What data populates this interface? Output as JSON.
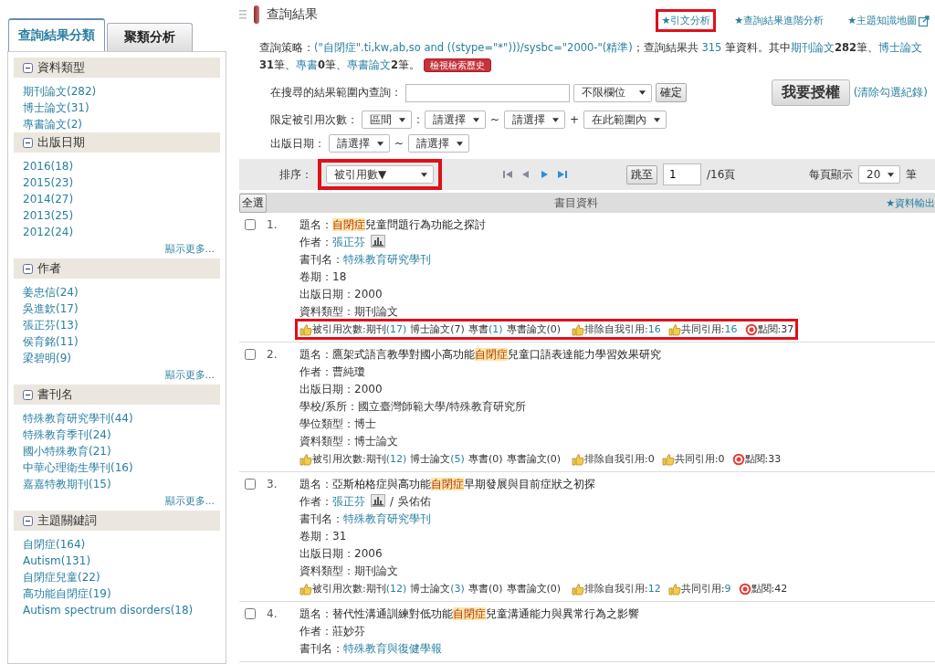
{
  "sidebar": {
    "tabs": [
      {
        "label": "查詢結果分類",
        "selected": true
      },
      {
        "label": "聚類分析",
        "selected": false
      }
    ],
    "sections": [
      {
        "title": "資料類型",
        "expanded": true,
        "items": [
          "期刊論文(282)",
          "博士論文(31)",
          "專書論文(2)"
        ]
      },
      {
        "title": "出版日期",
        "expanded": true,
        "items": [
          "2016(18)",
          "2015(23)",
          "2014(27)",
          "2013(25)",
          "2012(24)"
        ],
        "more": "顯示更多..."
      },
      {
        "title": "作者",
        "expanded": true,
        "items": [
          "姜忠信(24)",
          "吳進欽(17)",
          "張正芬(13)",
          "侯育銘(11)",
          "梁碧明(9)"
        ],
        "more": "顯示更多..."
      },
      {
        "title": "書刊名",
        "expanded": true,
        "items": [
          "特殊教育研究學刊(44)",
          "特殊教育季刊(24)",
          "國小特殊教育(21)",
          "中華心理衛生學刊(16)",
          "嘉嘉特教期刊(15)"
        ],
        "more": "顯示更多..."
      },
      {
        "title": "主題關鍵詞",
        "expanded": true,
        "items": [
          "自閉症(164)",
          "Autism(131)",
          "自閉症兒童(22)",
          "高功能自閉症(19)",
          "Autism spectrum disorders(18)"
        ]
      }
    ]
  },
  "header": {
    "title": "查詢結果",
    "links": [
      {
        "text": "★引文分析",
        "boxed": true,
        "external": false
      },
      {
        "text": "★查詢結果進階分析",
        "boxed": false,
        "external": false
      },
      {
        "text": "★主題知識地圖",
        "boxed": false,
        "external": true
      }
    ]
  },
  "summary": [
    {
      "text": "查詢策略：",
      "kind": "plain"
    },
    {
      "text": "(\"自閉症\".ti,kw,ab,so and ((stype=\"*\")))/sysbc=\"2000-\"(精準)",
      "kind": "link"
    },
    {
      "text": "；查詢結果共 ",
      "kind": "plain"
    },
    {
      "text": "315",
      "kind": "link"
    },
    {
      "text": " 筆資料。其中",
      "kind": "plain"
    },
    {
      "text": "期刊論文",
      "kind": "link"
    },
    {
      "text": "282",
      "kind": "bold"
    },
    {
      "text": "筆、",
      "kind": "plain"
    },
    {
      "text": "博士論文",
      "kind": "link"
    },
    {
      "text": "31",
      "kind": "bold"
    },
    {
      "text": "筆、",
      "kind": "plain"
    },
    {
      "text": "專書",
      "kind": "link"
    },
    {
      "text": "0",
      "kind": "bold"
    },
    {
      "text": "筆、",
      "kind": "plain"
    },
    {
      "text": "專書論文",
      "kind": "link"
    },
    {
      "text": "2",
      "kind": "bold"
    },
    {
      "text": "筆。",
      "kind": "plain"
    }
  ],
  "history_button": "檢視檢索歷史",
  "range_search": {
    "label": "在搜尋的結果範圍內查詢：",
    "field_select": "不限欄位",
    "button": "確定"
  },
  "license_button": "我要授權",
  "clear_link": "(清除勾選紀錄)",
  "citation_filter": {
    "label": "限定被引用次數：",
    "mode": "區間",
    "sep1": ":",
    "from": "請選擇",
    "sep2": "~",
    "to": "請選擇",
    "sep3": "+",
    "scope": "在此範圍內"
  },
  "date_filter": {
    "label": "出版日期：",
    "from": "請選擇",
    "sep": "~",
    "to": "請選擇"
  },
  "toolbar": {
    "sort_label": "排序：",
    "sort_value": "被引用數▼",
    "sort_boxed": true,
    "jump_button": "跳至",
    "page_value": "1",
    "page_total": "/16頁",
    "per_page_label": "每頁顯示",
    "per_page": "20",
    "per_page_unit": "筆"
  },
  "table_header": {
    "select_all": "全選",
    "column": "書目資料",
    "export": "★資料輸出"
  },
  "records": [
    {
      "number": "1.",
      "checked": false,
      "title_label": "題名：",
      "title_parts": [
        {
          "text": "自閉症",
          "highlight": true
        },
        {
          "text": "兒童問題行為功能之探討",
          "highlight": false
        }
      ],
      "fields": [
        {
          "label": "作者：",
          "values": [
            {
              "text": "張正芬",
              "link": true,
              "profile": true
            }
          ]
        },
        {
          "label": "書刊名：",
          "values": [
            {
              "text": "特殊教育研究學刊",
              "link": true,
              "profile": false
            }
          ]
        },
        {
          "label": "卷期：",
          "values": [
            {
              "text": "18",
              "link": false,
              "profile": false
            }
          ]
        },
        {
          "label": "出版日期：",
          "values": [
            {
              "text": "2000",
              "link": false,
              "profile": false
            }
          ]
        },
        {
          "label": "資料類型：",
          "values": [
            {
              "text": "期刊論文",
              "link": false,
              "profile": false
            }
          ]
        }
      ],
      "citation": {
        "boxed": true,
        "label": "被引用次數:",
        "counts": [
          {
            "label": "期刊",
            "count": "(17)",
            "link": true
          },
          {
            "label": "博士論文",
            "count": "(7)",
            "link": false
          },
          {
            "label": "專書",
            "count": "(1)",
            "link": true
          },
          {
            "label": "專書論文",
            "count": "(0)",
            "link": false
          }
        ],
        "self_label": "排除自我引用:",
        "self_value": "16",
        "self_link": true,
        "co_label": "共同引用:",
        "co_value": "16",
        "co_link": true,
        "views_label": "點閱:",
        "views": "37"
      }
    },
    {
      "number": "2.",
      "checked": false,
      "title_label": "題名：",
      "title_parts": [
        {
          "text": "鷹架式語言教學對國小高功能",
          "highlight": false
        },
        {
          "text": "自閉症",
          "highlight": true
        },
        {
          "text": "兒童口語表達能力學習效果研究",
          "highlight": false
        }
      ],
      "fields": [
        {
          "label": "作者：",
          "values": [
            {
              "text": "曹純瓊",
              "link": false,
              "profile": false
            }
          ]
        },
        {
          "label": "出版日期：",
          "values": [
            {
              "text": "2000",
              "link": false,
              "profile": false
            }
          ]
        },
        {
          "label": "學校/系所：",
          "values": [
            {
              "text": "國立臺灣師範大學/特殊教育研究所",
              "link": false,
              "profile": false
            }
          ]
        },
        {
          "label": "學位類型：",
          "values": [
            {
              "text": "博士",
              "link": false,
              "profile": false
            }
          ]
        },
        {
          "label": "資料類型：",
          "values": [
            {
              "text": "博士論文",
              "link": false,
              "profile": false
            }
          ]
        }
      ],
      "citation": {
        "boxed": false,
        "label": "被引用次數:",
        "counts": [
          {
            "label": "期刊",
            "count": "(12)",
            "link": true
          },
          {
            "label": "博士論文",
            "count": "(5)",
            "link": true
          },
          {
            "label": "專書",
            "count": "(0)",
            "link": false
          },
          {
            "label": "專書論文",
            "count": "(0)",
            "link": false
          }
        ],
        "self_label": "排除自我引用:",
        "self_value": "0",
        "self_link": false,
        "co_label": "共同引用:",
        "co_value": "0",
        "co_link": false,
        "views_label": "點閱:",
        "views": "33"
      }
    },
    {
      "number": "3.",
      "checked": false,
      "title_label": "題名：",
      "title_parts": [
        {
          "text": "亞斯柏格症與高功能",
          "highlight": false
        },
        {
          "text": "自閉症",
          "highlight": true
        },
        {
          "text": "早期發展與目前症狀之初探",
          "highlight": false
        }
      ],
      "fields": [
        {
          "label": "作者：",
          "separator": "/",
          "values": [
            {
              "text": "張正芬",
              "link": true,
              "profile": true
            },
            {
              "text": "吳佑佑",
              "link": false,
              "profile": false
            }
          ]
        },
        {
          "label": "書刊名：",
          "values": [
            {
              "text": "特殊教育研究學刊",
              "link": true,
              "profile": false
            }
          ]
        },
        {
          "label": "卷期：",
          "values": [
            {
              "text": "31",
              "link": false,
              "profile": false
            }
          ]
        },
        {
          "label": "出版日期：",
          "values": [
            {
              "text": "2006",
              "link": false,
              "profile": false
            }
          ]
        },
        {
          "label": "資料類型：",
          "values": [
            {
              "text": "期刊論文",
              "link": false,
              "profile": false
            }
          ]
        }
      ],
      "citation": {
        "boxed": false,
        "label": "被引用次數:",
        "counts": [
          {
            "label": "期刊",
            "count": "(12)",
            "link": true
          },
          {
            "label": "博士論文",
            "count": "(3)",
            "link": true
          },
          {
            "label": "專書",
            "count": "(0)",
            "link": false
          },
          {
            "label": "專書論文",
            "count": "(0)",
            "link": false
          }
        ],
        "self_label": "排除自我引用:",
        "self_value": "12",
        "self_link": true,
        "co_label": "共同引用:",
        "co_value": "9",
        "co_link": true,
        "views_label": "點閱:",
        "views": "42"
      }
    },
    {
      "number": "4.",
      "checked": false,
      "title_label": "題名：",
      "title_parts": [
        {
          "text": "替代性溝通訓練對低功能",
          "highlight": false
        },
        {
          "text": "自閉症",
          "highlight": true
        },
        {
          "text": "兒童溝通能力與異常行為之影響",
          "highlight": false
        }
      ],
      "fields": [
        {
          "label": "作者：",
          "values": [
            {
              "text": "莊妙芬",
              "link": false,
              "profile": false
            }
          ]
        },
        {
          "label": "書刊名：",
          "values": [
            {
              "text": "特殊教育與復健學報",
              "link": true,
              "profile": false
            }
          ]
        }
      ]
    }
  ]
}
